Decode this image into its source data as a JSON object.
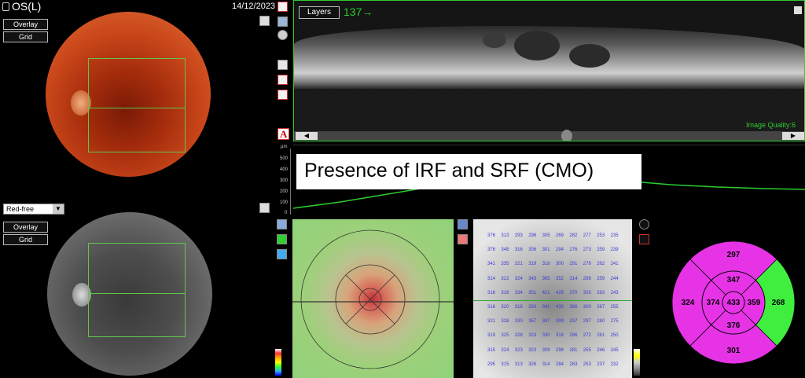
{
  "header": {
    "eye": "OS(L)",
    "date": "14/12/2023"
  },
  "fundus_panel": {
    "overlay_label": "Overlay",
    "grid_label": "Grid"
  },
  "redfree_panel": {
    "mode_value": "Red-free",
    "overlay_label": "Overlay",
    "grid_label": "Grid"
  },
  "oct_panel": {
    "layers_label": "Layers",
    "slice_indicator": "137→",
    "quality_label": "Image Quality:6"
  },
  "thickness_profile": {
    "unit": "μm",
    "ticks": [
      "500",
      "400",
      "300",
      "200",
      "100",
      "0"
    ]
  },
  "annotation": {
    "text": "Presence of IRF and SRF (CMO)"
  },
  "tools": {
    "text_tool_glyph": "A"
  },
  "thickness_grid": {
    "rows": [
      [
        "376",
        "313",
        "293",
        "296",
        "305",
        "269",
        "282",
        "277",
        "253",
        "235"
      ],
      [
        "376",
        "348",
        "316",
        "306",
        "301",
        "294",
        "276",
        "273",
        "259",
        "239"
      ],
      [
        "341",
        "335",
        "321",
        "319",
        "318",
        "300",
        "291",
        "278",
        "262",
        "241"
      ],
      [
        "314",
        "322",
        "324",
        "343",
        "365",
        "352",
        "314",
        "288",
        "259",
        "244"
      ],
      [
        "316",
        "316",
        "334",
        "301",
        "421",
        "429",
        "370",
        "303",
        "263",
        "243"
      ],
      [
        "316",
        "320",
        "318",
        "330",
        "341",
        "430",
        "366",
        "300",
        "267",
        "255"
      ],
      [
        "321",
        "328",
        "330",
        "357",
        "387",
        "399",
        "337",
        "297",
        "280",
        "275"
      ],
      [
        "319",
        "325",
        "328",
        "323",
        "330",
        "318",
        "296",
        "272",
        "261",
        "250"
      ],
      [
        "315",
        "324",
        "323",
        "323",
        "309",
        "298",
        "281",
        "255",
        "246",
        "245"
      ],
      [
        "295",
        "315",
        "313",
        "326",
        "314",
        "284",
        "263",
        "253",
        "237",
        "232"
      ]
    ]
  },
  "etdrs": {
    "outer_superior": "297",
    "inner_superior": "347",
    "outer_nasal": "324",
    "inner_nasal": "374",
    "center": "433",
    "inner_temporal": "359",
    "outer_temporal": "268",
    "inner_inferior": "376",
    "outer_inferior": "301"
  },
  "colors": {
    "accent_green": "#3fbf3f",
    "etdrs_magenta": "#e633e6",
    "etdrs_green": "#40ee40"
  }
}
